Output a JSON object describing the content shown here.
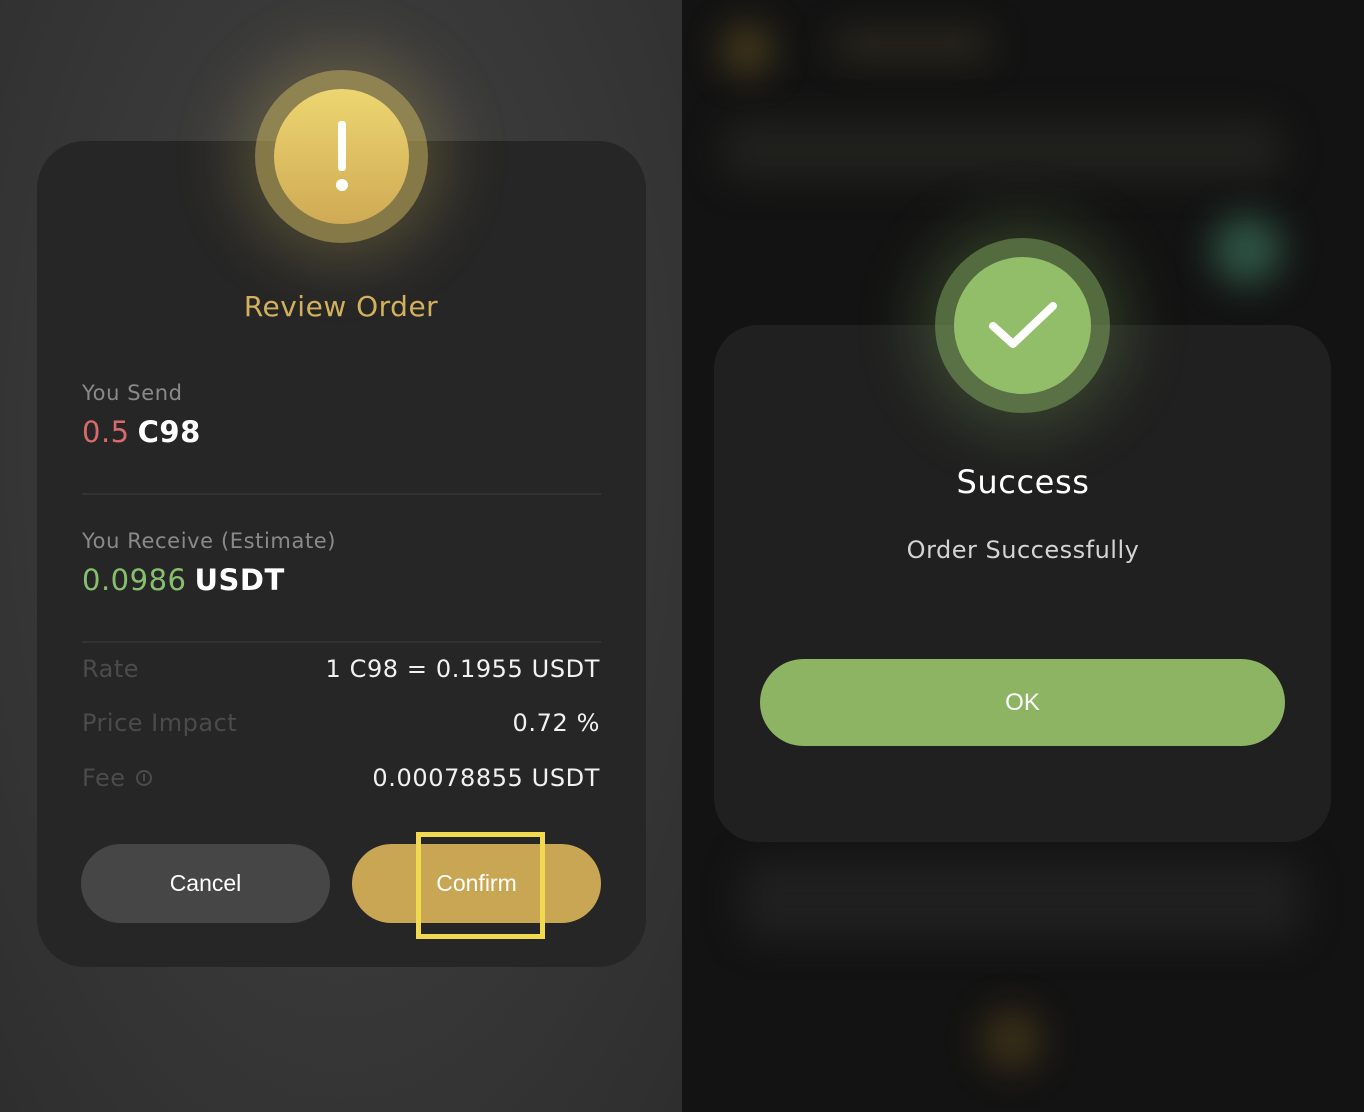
{
  "review": {
    "icon": "exclamation-icon",
    "title": "Review Order",
    "send_label": "You Send",
    "send_amount": "0.5",
    "send_token": "C98",
    "receive_label": "You Receive (Estimate)",
    "receive_amount": "0.0986",
    "receive_token": "USDT",
    "rows": [
      {
        "label": "Rate",
        "value": "1 C98 = 0.1955 USDT"
      },
      {
        "label": "Price Impact",
        "value": "0.72 %"
      },
      {
        "label": "Fee",
        "value": "0.00078855 USDT",
        "icon": "info-icon"
      }
    ],
    "cancel_label": "Cancel",
    "confirm_label": "Confirm"
  },
  "success": {
    "icon": "checkmark-icon",
    "title": "Success",
    "message": "Order Successfully",
    "ok_label": "OK"
  },
  "colors": {
    "accent_gold": "#c9a653",
    "title_gold": "#d3b15c",
    "send_red": "#d8696c",
    "receive_green": "#86c06f",
    "success_green": "#8db463",
    "highlight_yellow": "#f1da4f"
  }
}
